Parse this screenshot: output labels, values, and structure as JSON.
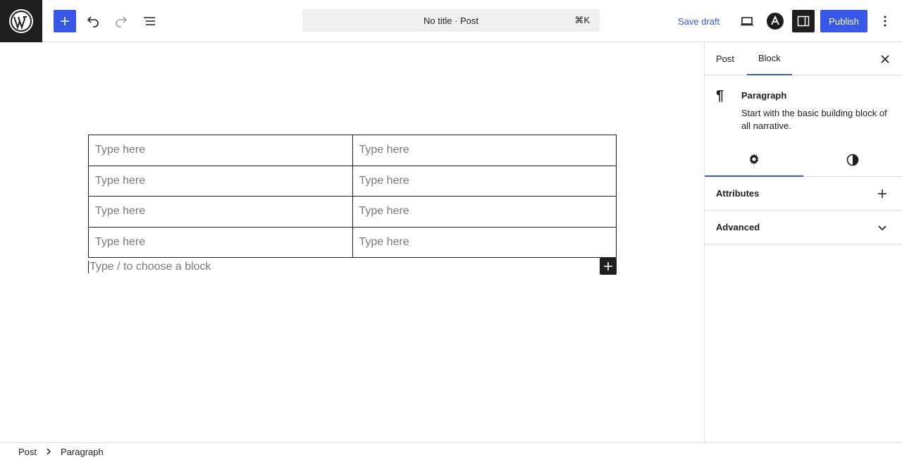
{
  "topbar": {
    "title": "No title · Post",
    "shortcut": "⌘K",
    "save_draft": "Save draft",
    "publish": "Publish"
  },
  "table": {
    "rows": [
      [
        "Type here",
        "Type here"
      ],
      [
        "Type here",
        "Type here"
      ],
      [
        "Type here",
        "Type here"
      ],
      [
        "Type here",
        "Type here"
      ]
    ]
  },
  "canvas": {
    "paragraph_placeholder": "Type / to choose a block"
  },
  "sidebar": {
    "tabs": [
      "Post",
      "Block"
    ],
    "active_tab": "Block",
    "block_name": "Paragraph",
    "block_description": "Start with the basic building block of all narrative.",
    "panels": [
      "Attributes",
      "Advanced"
    ]
  },
  "breadcrumb": [
    "Post",
    "Paragraph"
  ],
  "colors": {
    "accent": "#3858e9",
    "dark": "#1e1e1e",
    "placeholder": "#7a7a7a",
    "border": "#e0e0e0"
  },
  "icons": [
    "wordpress-logo",
    "plus-icon",
    "undo-icon",
    "redo-icon",
    "list-view-icon",
    "desktop-preview-icon",
    "astra-icon",
    "sidebar-toggle-icon",
    "more-vertical-icon",
    "close-icon",
    "pilcrow-icon",
    "gear-icon",
    "half-circle-icon",
    "chevron-down-icon",
    "chevron-right-icon"
  ]
}
